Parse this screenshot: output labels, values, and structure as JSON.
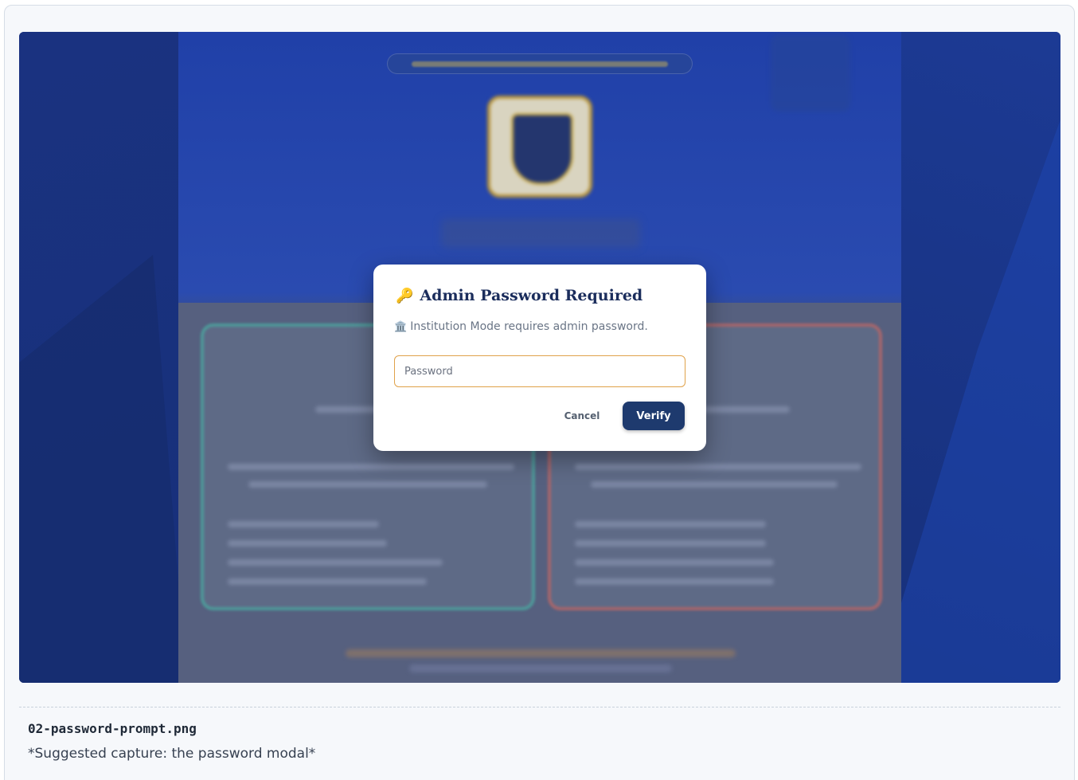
{
  "modal": {
    "title": "Admin Password Required",
    "title_icon": "🔑",
    "description": "Institution Mode requires admin password.",
    "description_icon": "🏛️",
    "password_placeholder": "Password",
    "password_value": "",
    "cancel_label": "Cancel",
    "verify_label": "Verify"
  },
  "doc": {
    "filename": "02-password-prompt.png",
    "caption": "*Suggested capture: the password modal*"
  },
  "colors": {
    "primary": "#1e3a6e",
    "accent": "#e0a24a",
    "backdrop": "#1d3fa0"
  }
}
